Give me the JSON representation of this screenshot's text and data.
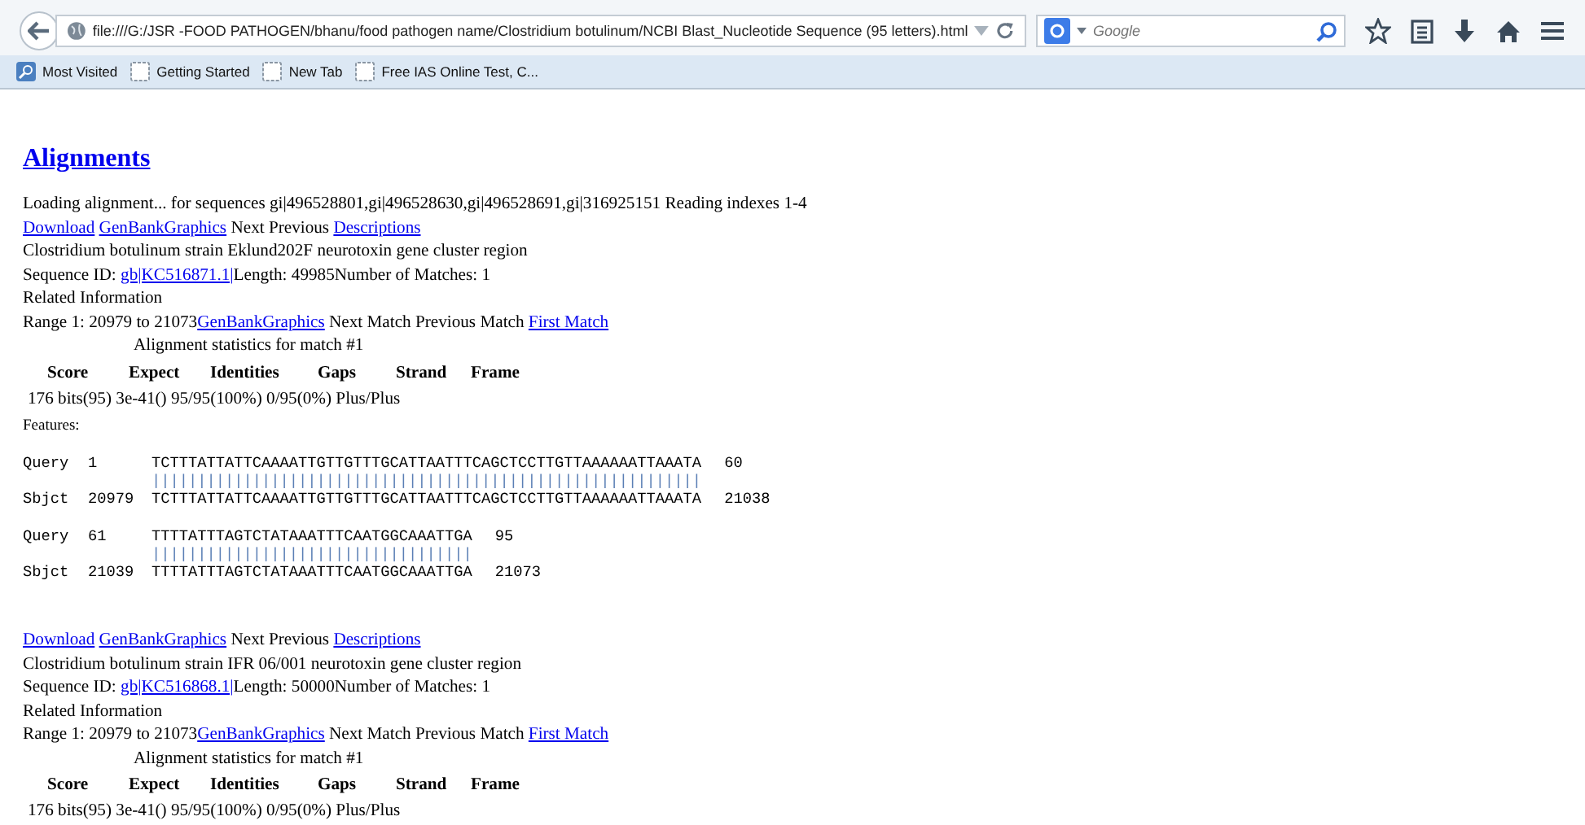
{
  "browser": {
    "url": "file:///G:/JSR -FOOD PATHOGEN/bhanu/food pathogen name/Clostridium botulinum/NCBI Blast_Nucleotide Sequence (95 letters).html",
    "search": {
      "placeholder": "Google"
    },
    "bookmarks": [
      {
        "label": "Most Visited",
        "kind": "smart"
      },
      {
        "label": "Getting Started",
        "kind": "page"
      },
      {
        "label": "New Tab",
        "kind": "page"
      },
      {
        "label": "Free IAS Online Test, C...",
        "kind": "page"
      }
    ]
  },
  "heading": "Alignments",
  "loading": "Loading alignment... for sequences gi|496528801,gi|496528630,gi|496528691,gi|316925151 Reading indexes 1-4",
  "hits": [
    {
      "nav": [
        {
          "kind": "link",
          "text": "Download"
        },
        {
          "kind": "link",
          "text": "GenBankGraphics"
        },
        {
          "kind": "text",
          "text": " Next Previous "
        },
        {
          "kind": "link",
          "text": "Descriptions"
        }
      ],
      "description": "Clostridium botulinum strain Eklund202F neurotoxin gene cluster region",
      "sequence_id": [
        {
          "kind": "text",
          "text": "Sequence ID: "
        },
        {
          "kind": "link",
          "text": "gb|KC516871.1|"
        },
        {
          "kind": "text",
          "text": "Length: 49985Number of Matches: 1"
        }
      ],
      "related": "Related Information",
      "range": [
        {
          "kind": "text",
          "text": "Range 1: 20979 to 21073"
        },
        {
          "kind": "link",
          "text": "GenBankGraphics"
        },
        {
          "kind": "text",
          "text": " Next Match Previous Match "
        },
        {
          "kind": "link",
          "text": "First Match"
        }
      ],
      "stats_caption": "Alignment statistics for match #1",
      "stats_columns": [
        "Score",
        "Expect",
        "Identities",
        "Gaps",
        "Strand",
        "Frame"
      ],
      "stats_values": "176 bits(95) 3e-41() 95/95(100%) 0/95(0%) Plus/Plus",
      "features": "Features:",
      "alignment": [
        {
          "query": {
            "label": "Query",
            "start": "1",
            "seq": "TCTTTATTATTCAAAATTGTTGTTTGCATTAATTTCAGCTCCTTGTTAAAAAATTAAATA",
            "end": "60"
          },
          "match": "||||||||||||||||||||||||||||||||||||||||||||||||||||||||||||",
          "sbjct": {
            "label": "Sbjct",
            "start": "20979",
            "seq": "TCTTTATTATTCAAAATTGTTGTTTGCATTAATTTCAGCTCCTTGTTAAAAAATTAAATA",
            "end": "21038"
          }
        },
        {
          "query": {
            "label": "Query",
            "start": "61",
            "seq": "TTTTATTTAGTCTATAAATTTCAATGGCAAATTGA",
            "end": "95"
          },
          "match": "|||||||||||||||||||||||||||||||||||",
          "sbjct": {
            "label": "Sbjct",
            "start": "21039",
            "seq": "TTTTATTTAGTCTATAAATTTCAATGGCAAATTGA",
            "end": "21073"
          }
        }
      ]
    },
    {
      "nav": [
        {
          "kind": "link",
          "text": "Download"
        },
        {
          "kind": "link",
          "text": "GenBankGraphics"
        },
        {
          "kind": "text",
          "text": " Next Previous "
        },
        {
          "kind": "link",
          "text": "Descriptions"
        }
      ],
      "description": "Clostridium botulinum strain IFR 06/001 neurotoxin gene cluster region",
      "sequence_id": [
        {
          "kind": "text",
          "text": "Sequence ID: "
        },
        {
          "kind": "link",
          "text": "gb|KC516868.1|"
        },
        {
          "kind": "text",
          "text": "Length: 50000Number of Matches: 1"
        }
      ],
      "related": "Related Information",
      "range": [
        {
          "kind": "text",
          "text": "Range 1: 20979 to 21073"
        },
        {
          "kind": "link",
          "text": "GenBankGraphics"
        },
        {
          "kind": "text",
          "text": " Next Match Previous Match "
        },
        {
          "kind": "link",
          "text": "First Match"
        }
      ],
      "stats_caption": "Alignment statistics for match #1",
      "stats_columns": [
        "Score",
        "Expect",
        "Identities",
        "Gaps",
        "Strand",
        "Frame"
      ],
      "stats_values": "176 bits(95) 3e-41() 95/95(100%) 0/95(0%) Plus/Plus"
    }
  ]
}
